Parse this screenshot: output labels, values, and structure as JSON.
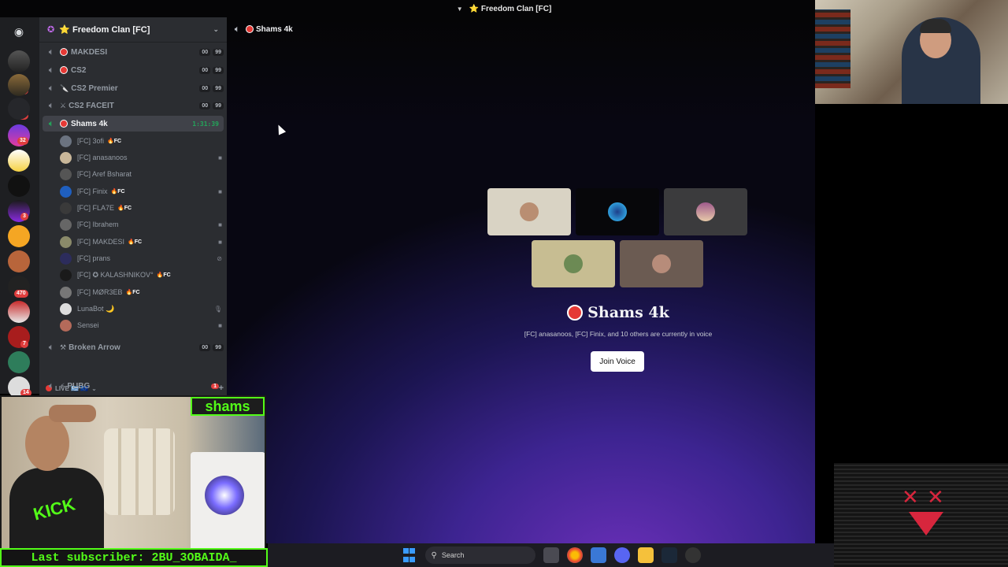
{
  "window": {
    "title": "⭐ Freedom Clan [FC]",
    "chevron": "▼"
  },
  "server": {
    "name": "⭐ Freedom Clan [FC]",
    "chevron": "⌄",
    "icon": "✪"
  },
  "rail": {
    "badges": [
      "134",
      "15",
      "32",
      "3",
      "470",
      "7",
      "14"
    ]
  },
  "channels": [
    {
      "name": "MAKDESI",
      "prefix_dot": true,
      "count": [
        "00",
        "99"
      ]
    },
    {
      "name": "CS2",
      "prefix_dot": true,
      "count": [
        "00",
        "99"
      ]
    },
    {
      "name": "CS2 Premier",
      "prefix": "🔪",
      "count": [
        "00",
        "99"
      ]
    },
    {
      "name": "CS2 FACEIT",
      "prefix": "⚔",
      "count": [
        "00",
        "99"
      ]
    },
    {
      "name": "Shams 4k",
      "prefix_dot": true,
      "timer": "1:31:39",
      "active": true
    }
  ],
  "members": [
    {
      "name": "[FC] 3ofi",
      "fc": "🔥FC",
      "icon": ""
    },
    {
      "name": "[FC] anasanoos",
      "fc": "",
      "icon": "■"
    },
    {
      "name": "[FC] Aref Bsharat",
      "fc": "",
      "icon": ""
    },
    {
      "name": "[FC] Finix",
      "fc": "🔥FC",
      "icon": "■"
    },
    {
      "name": "[FC] FLA7E",
      "fc": "🔥FC",
      "icon": ""
    },
    {
      "name": "[FC] Ibrahem",
      "fc": "",
      "icon": "■"
    },
    {
      "name": "[FC] MAKDESI",
      "fc": "🔥FC",
      "icon": "■"
    },
    {
      "name": "[FC] prans",
      "fc": "",
      "icon": "⊘"
    },
    {
      "name": "[FC] ✪ KALASHNIKOV°",
      "fc": "🔥FC",
      "icon": ""
    },
    {
      "name": "[FC] MØR3EB",
      "fc": "🔥FC",
      "icon": ""
    },
    {
      "name": "LunaBot 🌙",
      "fc": "",
      "icon": "🎙"
    },
    {
      "name": "Sensei",
      "fc": "",
      "icon": "■"
    }
  ],
  "broken_arrow": {
    "name": "Broken Arrow",
    "prefix": "⚒",
    "count": [
      "00",
      "99"
    ]
  },
  "live_category": {
    "label": "LIVE 🇬🇷 🇪🇺",
    "chevron": "⌄",
    "plus": "+"
  },
  "pubg": {
    "name": "PUBG",
    "prefix": "⚡",
    "badge": "1"
  },
  "main": {
    "header": "Shams 4k",
    "title": "Shams 4k",
    "subtitle": "[FC] anasanoos, [FC] Finix, and 10 others are currently in voice",
    "join_label": "Join Voice"
  },
  "stream": {
    "name_tag": "shams",
    "subscriber": "Last subscriber: 2BU_3OBAIDA_",
    "kick": "KICK"
  },
  "taskbar": {
    "search_label": "Search"
  },
  "colors": {
    "accent_green": "#53fc18",
    "live_red": "#e53935",
    "discord_bg": "#2b2d31"
  }
}
